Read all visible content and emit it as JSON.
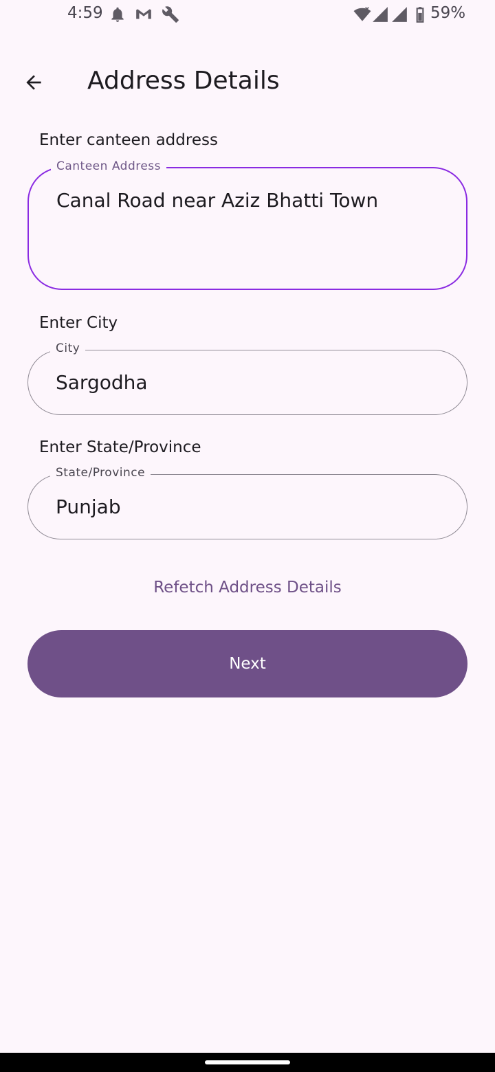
{
  "status_bar": {
    "time": "4:59",
    "battery": "59%",
    "icons": [
      "notification-bell-icon",
      "gmail-icon",
      "wrench-icon",
      "wifi-icon",
      "signal-icon",
      "signal-icon",
      "battery-icon"
    ]
  },
  "app_bar": {
    "title": "Address Details",
    "back_icon": "arrow-back-icon"
  },
  "address_section": {
    "label": "Enter canteen address",
    "field_label": "Canteen Address",
    "value": "Canal Road near Aziz Bhatti Town"
  },
  "city_section": {
    "label": "Enter City",
    "field_label": "City",
    "value": "Sargodha"
  },
  "state_section": {
    "label": "Enter State/Province",
    "field_label": "State/Province",
    "value": "Punjab"
  },
  "actions": {
    "refetch_label": "Refetch Address Details",
    "next_label": "Next"
  },
  "colors": {
    "background": "#fdf6fc",
    "primary": "#6f5088",
    "focus_border": "#8a2be2",
    "outline": "#8f8a94"
  }
}
